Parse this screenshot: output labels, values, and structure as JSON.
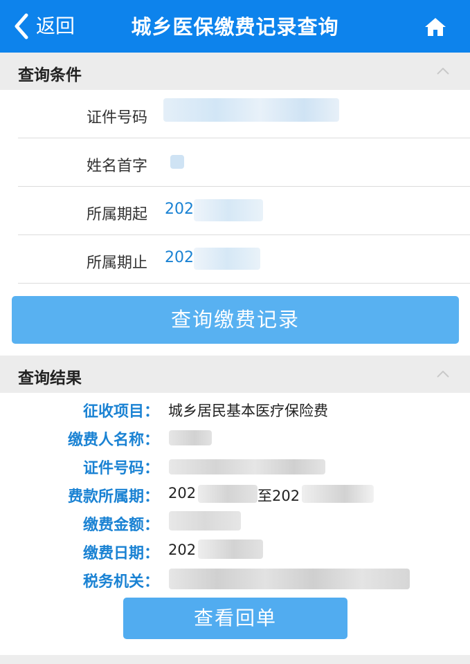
{
  "header": {
    "back_label": "返回",
    "title": "城乡医保缴费记录查询",
    "back_icon": "chevron-left-icon",
    "home_icon": "home-icon",
    "background_color": "#0d83ec"
  },
  "query_section": {
    "title": "查询条件",
    "collapse_icon": "chevron-up-icon",
    "fields": [
      {
        "label": "证件号码",
        "value": ""
      },
      {
        "label": "姓名首字",
        "value": ""
      },
      {
        "label": "所属期起",
        "value": "202"
      },
      {
        "label": "所属期止",
        "value": "202"
      }
    ],
    "submit_label": "查询缴费记录",
    "accent_color": "#58b1f1"
  },
  "result_section": {
    "title": "查询结果",
    "collapse_icon": "chevron-up-icon",
    "fields": [
      {
        "label": "征收项目：",
        "value": "城乡居民基本医疗保险费"
      },
      {
        "label": "缴费人名称：",
        "value": ""
      },
      {
        "label": "证件号码：",
        "value": ""
      },
      {
        "label": "费款所属期：",
        "value": "202",
        "value_mid": "至202"
      },
      {
        "label": "缴费金额：",
        "value": ""
      },
      {
        "label": "缴费日期：",
        "value": "202"
      },
      {
        "label": "税务机关：",
        "value": ""
      }
    ],
    "receipt_label": "查看回单",
    "label_color": "#1a82d3"
  }
}
